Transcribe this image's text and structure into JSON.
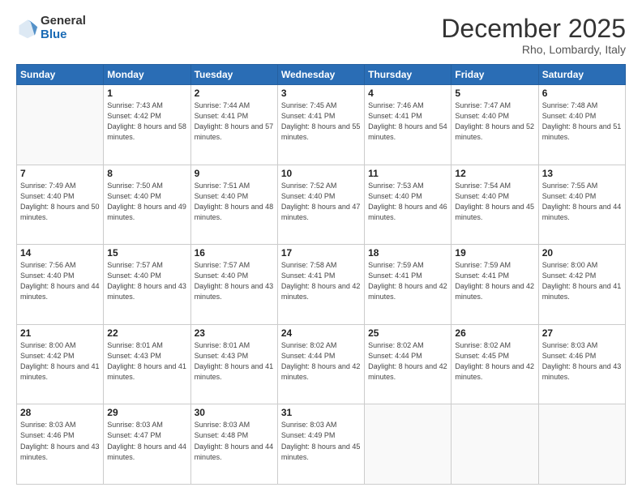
{
  "header": {
    "logo_general": "General",
    "logo_blue": "Blue",
    "month_year": "December 2025",
    "location": "Rho, Lombardy, Italy"
  },
  "days_of_week": [
    "Sunday",
    "Monday",
    "Tuesday",
    "Wednesday",
    "Thursday",
    "Friday",
    "Saturday"
  ],
  "weeks": [
    [
      {
        "day": "",
        "info": ""
      },
      {
        "day": "1",
        "info": "Sunrise: 7:43 AM\nSunset: 4:42 PM\nDaylight: 8 hours\nand 58 minutes."
      },
      {
        "day": "2",
        "info": "Sunrise: 7:44 AM\nSunset: 4:41 PM\nDaylight: 8 hours\nand 57 minutes."
      },
      {
        "day": "3",
        "info": "Sunrise: 7:45 AM\nSunset: 4:41 PM\nDaylight: 8 hours\nand 55 minutes."
      },
      {
        "day": "4",
        "info": "Sunrise: 7:46 AM\nSunset: 4:41 PM\nDaylight: 8 hours\nand 54 minutes."
      },
      {
        "day": "5",
        "info": "Sunrise: 7:47 AM\nSunset: 4:40 PM\nDaylight: 8 hours\nand 52 minutes."
      },
      {
        "day": "6",
        "info": "Sunrise: 7:48 AM\nSunset: 4:40 PM\nDaylight: 8 hours\nand 51 minutes."
      }
    ],
    [
      {
        "day": "7",
        "info": "Sunrise: 7:49 AM\nSunset: 4:40 PM\nDaylight: 8 hours\nand 50 minutes."
      },
      {
        "day": "8",
        "info": "Sunrise: 7:50 AM\nSunset: 4:40 PM\nDaylight: 8 hours\nand 49 minutes."
      },
      {
        "day": "9",
        "info": "Sunrise: 7:51 AM\nSunset: 4:40 PM\nDaylight: 8 hours\nand 48 minutes."
      },
      {
        "day": "10",
        "info": "Sunrise: 7:52 AM\nSunset: 4:40 PM\nDaylight: 8 hours\nand 47 minutes."
      },
      {
        "day": "11",
        "info": "Sunrise: 7:53 AM\nSunset: 4:40 PM\nDaylight: 8 hours\nand 46 minutes."
      },
      {
        "day": "12",
        "info": "Sunrise: 7:54 AM\nSunset: 4:40 PM\nDaylight: 8 hours\nand 45 minutes."
      },
      {
        "day": "13",
        "info": "Sunrise: 7:55 AM\nSunset: 4:40 PM\nDaylight: 8 hours\nand 44 minutes."
      }
    ],
    [
      {
        "day": "14",
        "info": "Sunrise: 7:56 AM\nSunset: 4:40 PM\nDaylight: 8 hours\nand 44 minutes."
      },
      {
        "day": "15",
        "info": "Sunrise: 7:57 AM\nSunset: 4:40 PM\nDaylight: 8 hours\nand 43 minutes."
      },
      {
        "day": "16",
        "info": "Sunrise: 7:57 AM\nSunset: 4:40 PM\nDaylight: 8 hours\nand 43 minutes."
      },
      {
        "day": "17",
        "info": "Sunrise: 7:58 AM\nSunset: 4:41 PM\nDaylight: 8 hours\nand 42 minutes."
      },
      {
        "day": "18",
        "info": "Sunrise: 7:59 AM\nSunset: 4:41 PM\nDaylight: 8 hours\nand 42 minutes."
      },
      {
        "day": "19",
        "info": "Sunrise: 7:59 AM\nSunset: 4:41 PM\nDaylight: 8 hours\nand 42 minutes."
      },
      {
        "day": "20",
        "info": "Sunrise: 8:00 AM\nSunset: 4:42 PM\nDaylight: 8 hours\nand 41 minutes."
      }
    ],
    [
      {
        "day": "21",
        "info": "Sunrise: 8:00 AM\nSunset: 4:42 PM\nDaylight: 8 hours\nand 41 minutes."
      },
      {
        "day": "22",
        "info": "Sunrise: 8:01 AM\nSunset: 4:43 PM\nDaylight: 8 hours\nand 41 minutes."
      },
      {
        "day": "23",
        "info": "Sunrise: 8:01 AM\nSunset: 4:43 PM\nDaylight: 8 hours\nand 41 minutes."
      },
      {
        "day": "24",
        "info": "Sunrise: 8:02 AM\nSunset: 4:44 PM\nDaylight: 8 hours\nand 42 minutes."
      },
      {
        "day": "25",
        "info": "Sunrise: 8:02 AM\nSunset: 4:44 PM\nDaylight: 8 hours\nand 42 minutes."
      },
      {
        "day": "26",
        "info": "Sunrise: 8:02 AM\nSunset: 4:45 PM\nDaylight: 8 hours\nand 42 minutes."
      },
      {
        "day": "27",
        "info": "Sunrise: 8:03 AM\nSunset: 4:46 PM\nDaylight: 8 hours\nand 43 minutes."
      }
    ],
    [
      {
        "day": "28",
        "info": "Sunrise: 8:03 AM\nSunset: 4:46 PM\nDaylight: 8 hours\nand 43 minutes."
      },
      {
        "day": "29",
        "info": "Sunrise: 8:03 AM\nSunset: 4:47 PM\nDaylight: 8 hours\nand 44 minutes."
      },
      {
        "day": "30",
        "info": "Sunrise: 8:03 AM\nSunset: 4:48 PM\nDaylight: 8 hours\nand 44 minutes."
      },
      {
        "day": "31",
        "info": "Sunrise: 8:03 AM\nSunset: 4:49 PM\nDaylight: 8 hours\nand 45 minutes."
      },
      {
        "day": "",
        "info": ""
      },
      {
        "day": "",
        "info": ""
      },
      {
        "day": "",
        "info": ""
      }
    ]
  ]
}
